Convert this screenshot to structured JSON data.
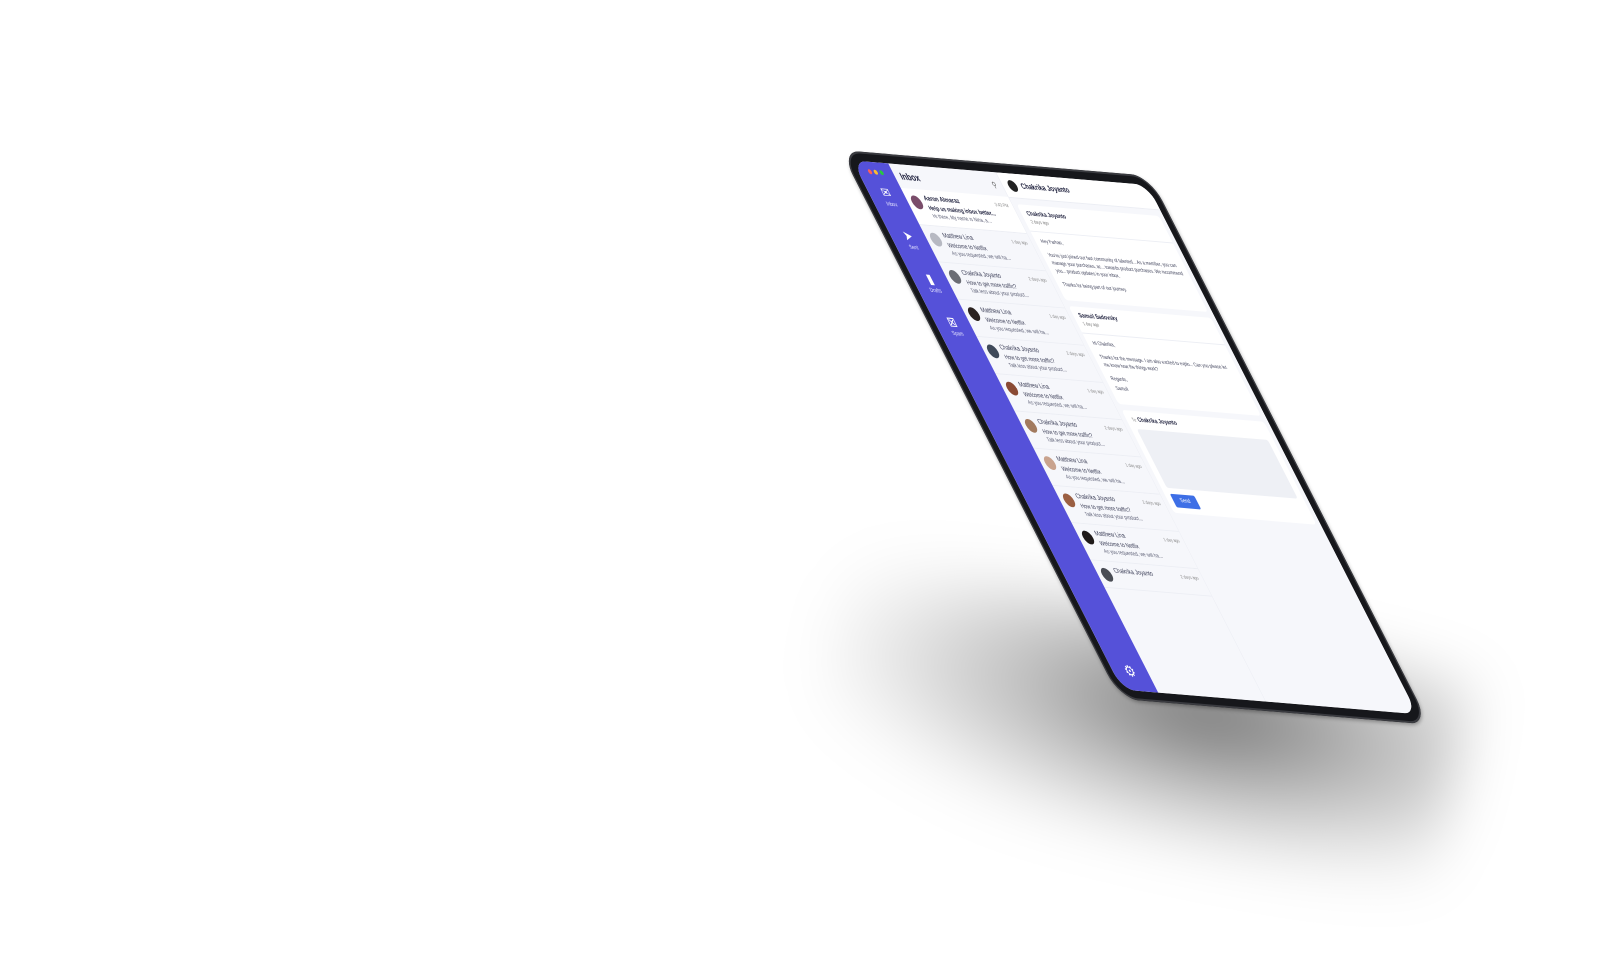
{
  "sidebar": {
    "items": [
      {
        "label": "Inbox",
        "icon": "envelope-icon",
        "glyph": "✉"
      },
      {
        "label": "Sent",
        "icon": "paper-plane-icon",
        "glyph": "➤"
      },
      {
        "label": "Drafts",
        "icon": "bookmark-icon",
        "glyph": "🔖"
      },
      {
        "label": "Spam",
        "icon": "spam-icon",
        "glyph": "⊠"
      }
    ],
    "settings_icon": "gear-icon",
    "settings_glyph": "⚙",
    "accent": "#5551d9"
  },
  "inbox": {
    "title": "Inbox",
    "search_glyph": "🔍",
    "mails": [
      {
        "name": "Aaron Almaraz",
        "time": "3:43 PM",
        "subject": "Help us making inbox better...",
        "preview": "Hi there, My name is Nina, a..."
      },
      {
        "name": "Matthew Lina",
        "time": "1 day ago",
        "subject": "Welcome to Netflix",
        "preview": "As you requested, we will ha..."
      },
      {
        "name": "Chakrika Joyanto",
        "time": "2 days ago",
        "subject": "How to get more traffic?",
        "preview": "Talk less about your product..."
      },
      {
        "name": "Matthew Lina",
        "time": "1 day ago",
        "subject": "Welcome to Netflix",
        "preview": "As you requested, we will ha..."
      },
      {
        "name": "Chakrika Joyanto",
        "time": "2 days ago",
        "subject": "How to get more traffic?",
        "preview": "Talk less about your product..."
      },
      {
        "name": "Matthew Lina",
        "time": "1 day ago",
        "subject": "Welcome to Netflix",
        "preview": "As you requested, we will ha..."
      },
      {
        "name": "Chakrika Joyanto",
        "time": "2 days ago",
        "subject": "How to get more traffic?",
        "preview": "Talk less about your product..."
      },
      {
        "name": "Matthew Lina",
        "time": "1 day ago",
        "subject": "Welcome to Netflix",
        "preview": "As you requested, we will ha..."
      },
      {
        "name": "Chakrika Joyanto",
        "time": "2 days ago",
        "subject": "How to get more traffic?",
        "preview": "Talk less about your product..."
      },
      {
        "name": "Matthew Lina",
        "time": "1 day ago",
        "subject": "Welcome to Netflix",
        "preview": "As you requested, we will ha..."
      },
      {
        "name": "Chakrika Joyanto",
        "time": "2 days ago",
        "subject": "",
        "preview": ""
      }
    ]
  },
  "conversation": {
    "title": "Chakrika Joyanto",
    "messages": [
      {
        "sender": "Chakrika Joyanto",
        "time": "2 days ago",
        "greeting": "Hey Farhan,",
        "body": "You've just joined our fast community of talented... As a member, you can manage your purchases, ac... towards product purchases. We recommend you... product updates in your inbox.",
        "closing": "Thanks for being part of our journey."
      },
      {
        "sender": "Samuil Sadovsky",
        "time": "1 day ago",
        "greeting": "Hi Chakrika,",
        "body": "Thanks for the message. I am also excited to explo... Can you please let me know how the things work?",
        "closing": "Regards,",
        "signature": "Samuil"
      }
    ],
    "reply": {
      "to_label": "To:",
      "to_name": "Chakrika Joyanto",
      "send_label": "Send"
    }
  }
}
